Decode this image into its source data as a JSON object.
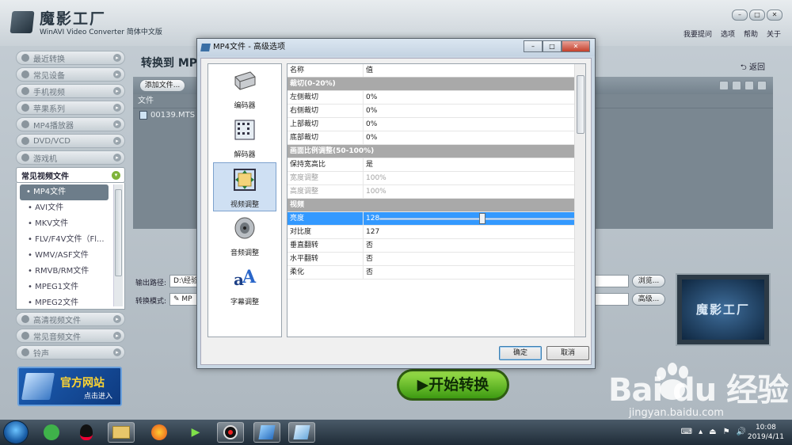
{
  "app": {
    "brand": "魔影工厂",
    "subtitle": "WinAVI Video Converter 简体中文版",
    "menu": [
      "我要提问",
      "选项",
      "帮助",
      "关于"
    ]
  },
  "sidebar": {
    "items_top": [
      "最近转换",
      "常见设备",
      "手机视频",
      "苹果系列",
      "MP4播放器",
      "DVD/VCD",
      "游戏机"
    ],
    "active": "常见视频文件",
    "sub_items": [
      "• MP4文件",
      "• AVI文件",
      "• MKV文件",
      "• FLV/F4V文件（Fl...",
      "• WMV/ASF文件",
      "• RMVB/RM文件",
      "• MPEG1文件",
      "• MPEG2文件"
    ],
    "items_bottom": [
      "高清视频文件",
      "常见音频文件",
      "铃声"
    ],
    "official": {
      "title": "官方网站",
      "sub": "点击进入"
    }
  },
  "main": {
    "title": "转换到 MP",
    "back": "返回",
    "add_file": "添加文件...",
    "file_header": "文件",
    "files": [
      "00139.MTS"
    ],
    "output_label": "输出路径:",
    "output_value": "D:\\经验",
    "browse": "浏览...",
    "mode_label": "转换模式:",
    "mode_value": "MP",
    "advanced": "高级...",
    "start": "开始转换"
  },
  "dialog": {
    "title": "MP4文件 - 高级选项",
    "categories": [
      "编码器",
      "解码器",
      "视频调整",
      "音频调整",
      "字幕调整"
    ],
    "table_head": {
      "name": "名称",
      "value": "值"
    },
    "rows": [
      {
        "type": "group",
        "name": "裁切(0-20%)"
      },
      {
        "type": "row",
        "name": "左侧裁切",
        "value": "0%"
      },
      {
        "type": "row",
        "name": "右侧裁切",
        "value": "0%"
      },
      {
        "type": "row",
        "name": "上部裁切",
        "value": "0%"
      },
      {
        "type": "row",
        "name": "底部裁切",
        "value": "0%"
      },
      {
        "type": "group",
        "name": "画面比例调整(50-100%)"
      },
      {
        "type": "row",
        "name": "保持宽高比",
        "value": "是"
      },
      {
        "type": "disabled",
        "name": "宽度调整",
        "value": "100%"
      },
      {
        "type": "disabled",
        "name": "高度调整",
        "value": "100%"
      },
      {
        "type": "group",
        "name": "视频"
      },
      {
        "type": "slider",
        "name": "亮度",
        "value": "128",
        "level": 0.5
      },
      {
        "type": "row",
        "name": "对比度",
        "value": "127"
      },
      {
        "type": "row",
        "name": "垂直翻转",
        "value": "否"
      },
      {
        "type": "row",
        "name": "水平翻转",
        "value": "否"
      },
      {
        "type": "row",
        "name": "柔化",
        "value": "否"
      }
    ],
    "ok": "确定",
    "cancel": "取消"
  },
  "watermark": {
    "text": "Bai du 经验",
    "url": "jingyan.baidu.com"
  },
  "taskbar": {
    "time": "10:08",
    "date": "2019/4/11"
  }
}
